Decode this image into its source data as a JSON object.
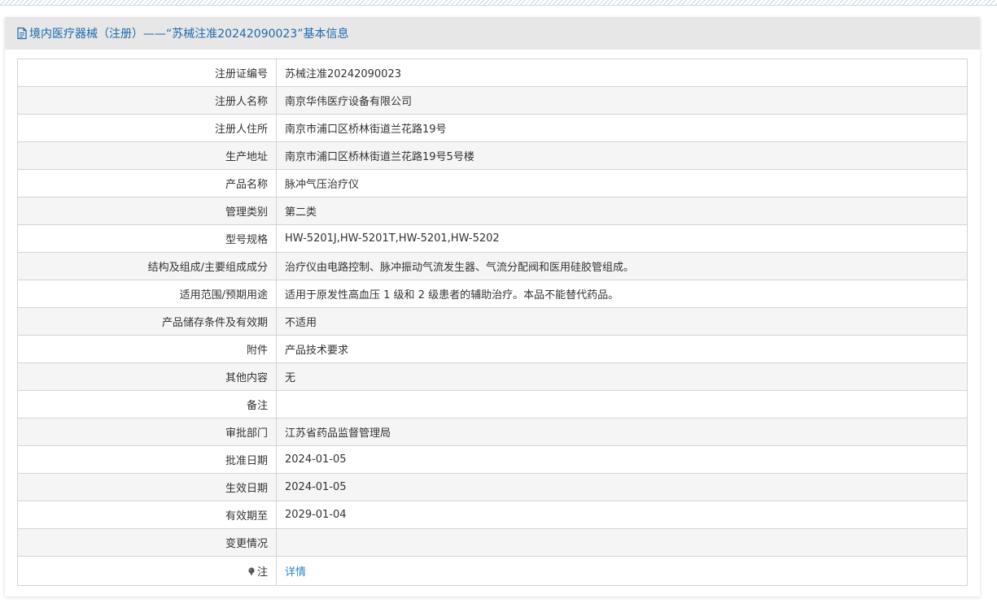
{
  "panel": {
    "title": "境内医疗器械（注册）——“苏械注准20242090023”基本信息"
  },
  "rows": [
    {
      "label": "注册证编号",
      "value": "苏械注准20242090023"
    },
    {
      "label": "注册人名称",
      "value": "南京华伟医疗设备有限公司"
    },
    {
      "label": "注册人住所",
      "value": "南京市浦口区桥林街道兰花路19号"
    },
    {
      "label": "生产地址",
      "value": "南京市浦口区桥林街道兰花路19号5号楼"
    },
    {
      "label": "产品名称",
      "value": "脉冲气压治疗仪"
    },
    {
      "label": "管理类别",
      "value": "第二类"
    },
    {
      "label": "型号规格",
      "value": "HW-5201J,HW-5201T,HW-5201,HW-5202"
    },
    {
      "label": "结构及组成/主要组成成分",
      "value": "治疗仪由电路控制、脉冲振动气流发生器、气流分配阀和医用硅胶管组成。"
    },
    {
      "label": "适用范围/预期用途",
      "value": "适用于原发性高血压 1 级和 2 级患者的辅助治疗。本品不能替代药品。"
    },
    {
      "label": "产品储存条件及有效期",
      "value": "不适用"
    },
    {
      "label": "附件",
      "value": "产品技术要求"
    },
    {
      "label": "其他内容",
      "value": "无"
    },
    {
      "label": "备注",
      "value": ""
    },
    {
      "label": "审批部门",
      "value": "江苏省药品监督管理局"
    },
    {
      "label": "批准日期",
      "value": "2024-01-05"
    },
    {
      "label": "生效日期",
      "value": "2024-01-05"
    },
    {
      "label": "有效期至",
      "value": "2029-01-04"
    },
    {
      "label": "变更情况",
      "value": ""
    }
  ],
  "note": {
    "icon": "pin-icon",
    "label": "注",
    "link_text": "详情"
  },
  "colors": {
    "title": "#1a6aae",
    "link": "#2a85c9",
    "header_bg": "#e7e7e7",
    "row_alt_bg": "#f5f5f5"
  }
}
